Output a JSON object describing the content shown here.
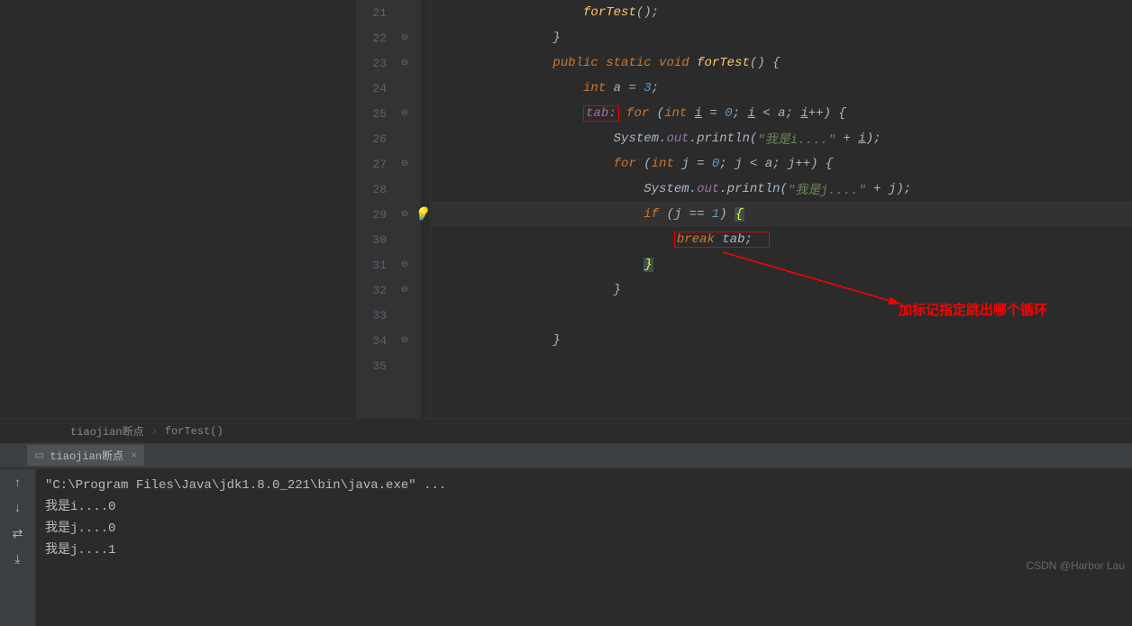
{
  "editor": {
    "lines": [
      {
        "num": 21,
        "fold": "",
        "indent": 5,
        "tokens": [
          [
            "forTest",
            "c-func"
          ],
          [
            "();",
            "c-plain"
          ]
        ]
      },
      {
        "num": 22,
        "fold": "up",
        "indent": 4,
        "tokens": [
          [
            "}",
            "c-plain"
          ]
        ]
      },
      {
        "num": 23,
        "fold": "down",
        "indent": 4,
        "tokens": [
          [
            "public ",
            "c-kw"
          ],
          [
            "static ",
            "c-kw"
          ],
          [
            "void ",
            "c-kw"
          ],
          [
            "forTest",
            "c-func"
          ],
          [
            "() {",
            "c-plain"
          ]
        ]
      },
      {
        "num": 24,
        "fold": "",
        "indent": 5,
        "tokens": [
          [
            "int ",
            "c-kw"
          ],
          [
            "a = ",
            "c-plain"
          ],
          [
            "3",
            "c-num"
          ],
          [
            ";",
            "c-plain"
          ]
        ]
      },
      {
        "num": 25,
        "fold": "down",
        "indent": 5,
        "redbox": [
          0,
          0
        ],
        "tokens": [
          [
            "tab:",
            "c-field"
          ],
          [
            " ",
            "c-plain"
          ],
          [
            "for ",
            "c-kw"
          ],
          [
            "(",
            "c-plain"
          ],
          [
            "int ",
            "c-kw"
          ],
          [
            "i",
            "c-id underline"
          ],
          [
            " = ",
            "c-plain"
          ],
          [
            "0",
            "c-num"
          ],
          [
            "; ",
            "c-plain"
          ],
          [
            "i",
            "c-id underline"
          ],
          [
            " < a; ",
            "c-plain"
          ],
          [
            "i",
            "c-id underline"
          ],
          [
            "++) {",
            "c-plain"
          ]
        ]
      },
      {
        "num": 26,
        "fold": "",
        "indent": 6,
        "tokens": [
          [
            "System.",
            "c-plain"
          ],
          [
            "out",
            "c-field"
          ],
          [
            ".println(",
            "c-plain"
          ],
          [
            "\"我是i....\"",
            "c-str"
          ],
          [
            " + ",
            "c-plain"
          ],
          [
            "i",
            "c-id underline"
          ],
          [
            ");",
            "c-plain"
          ]
        ]
      },
      {
        "num": 27,
        "fold": "down",
        "indent": 6,
        "tokens": [
          [
            "for ",
            "c-kw"
          ],
          [
            "(",
            "c-plain"
          ],
          [
            "int ",
            "c-kw"
          ],
          [
            "j = ",
            "c-plain"
          ],
          [
            "0",
            "c-num"
          ],
          [
            "; j < a; j++) {",
            "c-plain"
          ]
        ]
      },
      {
        "num": 28,
        "fold": "",
        "indent": 7,
        "tokens": [
          [
            "System.",
            "c-plain"
          ],
          [
            "out",
            "c-field"
          ],
          [
            ".println(",
            "c-plain"
          ],
          [
            "\"我是j....\"",
            "c-str"
          ],
          [
            " + j);",
            "c-plain"
          ]
        ]
      },
      {
        "num": 29,
        "fold": "down",
        "bulb": true,
        "highlight": true,
        "indent": 7,
        "tokens": [
          [
            "if ",
            "c-kw"
          ],
          [
            "(j == ",
            "c-plain"
          ],
          [
            "1",
            "c-num"
          ],
          [
            ") ",
            "c-plain"
          ],
          [
            "{",
            "highlight-brace"
          ]
        ]
      },
      {
        "num": 30,
        "fold": "",
        "indent": 8,
        "redbox2": true,
        "tokens": [
          [
            "break ",
            "c-kw"
          ],
          [
            "tab;",
            "c-plain"
          ]
        ]
      },
      {
        "num": 31,
        "fold": "up",
        "indent": 7,
        "tokens": [
          [
            "}",
            "highlight-brace"
          ]
        ]
      },
      {
        "num": 32,
        "fold": "up",
        "indent": 6,
        "tokens": [
          [
            "}",
            "c-plain"
          ]
        ]
      },
      {
        "num": 33,
        "fold": "",
        "indent": 5,
        "tokens": []
      },
      {
        "num": 34,
        "fold": "up",
        "indent": 4,
        "tokens": [
          [
            "}",
            "c-plain"
          ]
        ]
      },
      {
        "num": 35,
        "fold": "",
        "indent": 0,
        "tokens": []
      }
    ],
    "annotation_text": "加标记指定跳出哪个循环"
  },
  "breadcrumb": {
    "item1": "tiaojian断点",
    "item2": "forTest()"
  },
  "run": {
    "tab_label": "tiaojian断点",
    "console": {
      "path": "\"C:\\Program Files\\Java\\jdk1.8.0_221\\bin\\java.exe\" ...",
      "lines": [
        "我是i....0",
        "我是j....0",
        "我是j....1"
      ]
    }
  },
  "watermark": "CSDN @Harbor Lau"
}
